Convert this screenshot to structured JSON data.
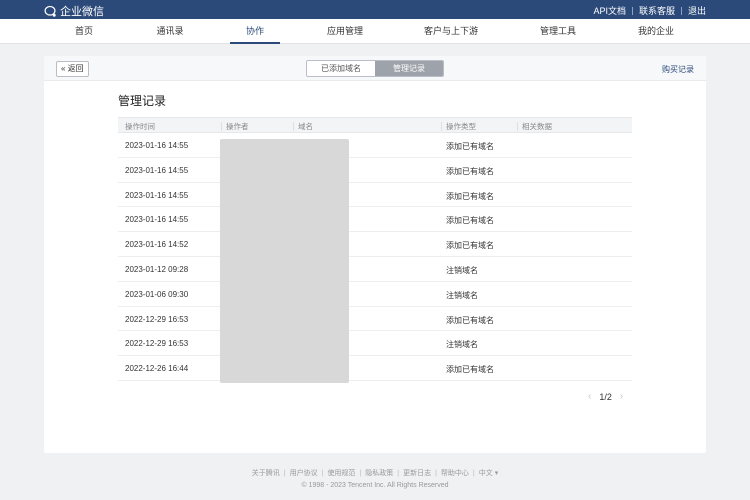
{
  "topbar": {
    "app_name": "企业微信",
    "links": [
      "API文档",
      "联系客服",
      "退出"
    ]
  },
  "nav": {
    "items": [
      "首页",
      "通讯录",
      "协作",
      "应用管理",
      "客户与上下游",
      "管理工具",
      "我的企业"
    ],
    "active": "协作"
  },
  "card": {
    "back_label": "« 返回",
    "tabs": [
      "已添加域名",
      "管理记录"
    ],
    "active_tab": "管理记录",
    "buy_label": "购买记录"
  },
  "page_title": "管理记录",
  "table": {
    "columns": [
      "操作时间",
      "操作者",
      "域名",
      "操作类型",
      "相关数据"
    ],
    "rows": [
      {
        "time": "2023-01-16 14:55",
        "type": "添加已有域名"
      },
      {
        "time": "2023-01-16 14:55",
        "type": "添加已有域名"
      },
      {
        "time": "2023-01-16 14:55",
        "type": "添加已有域名"
      },
      {
        "time": "2023-01-16 14:55",
        "type": "添加已有域名"
      },
      {
        "time": "2023-01-16 14:52",
        "type": "添加已有域名"
      },
      {
        "time": "2023-01-12 09:28",
        "type": "注销域名"
      },
      {
        "time": "2023-01-06 09:30",
        "type": "注销域名"
      },
      {
        "time": "2022-12-29 16:53",
        "type": "添加已有域名"
      },
      {
        "time": "2022-12-29 16:53",
        "type": "注销域名"
      },
      {
        "time": "2022-12-26 16:44",
        "type": "添加已有域名"
      }
    ]
  },
  "pager": {
    "prev": "‹",
    "label": "1/2",
    "next": "›"
  },
  "footer": {
    "links": [
      "关于腾讯",
      "用户协议",
      "使用规范",
      "隐私政策",
      "更新日志",
      "帮助中心",
      "中文 ▾"
    ],
    "copyright": "© 1998 - 2023 Tencent Inc. All Rights Reserved"
  },
  "colors": {
    "topbar": "#2b4a7a",
    "segment_active": "#9ea2aa",
    "masked_area": "#d8d8d8"
  }
}
